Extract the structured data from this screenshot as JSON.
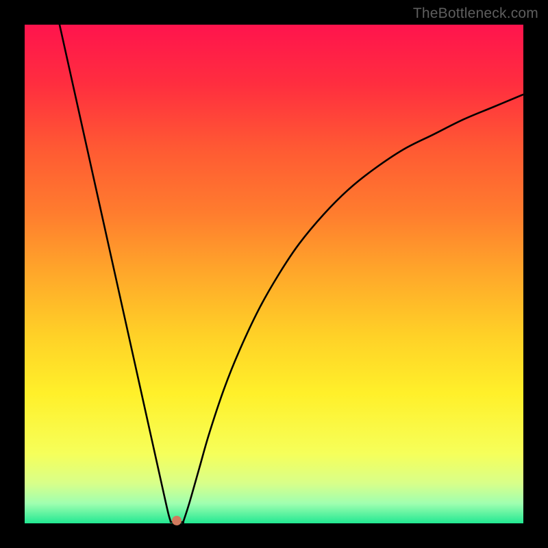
{
  "watermark": "TheBottleneck.com",
  "chart_data": {
    "type": "line",
    "title": "",
    "xlabel": "",
    "ylabel": "",
    "xlim": [
      0,
      100
    ],
    "ylim": [
      0,
      100
    ],
    "background_gradient": {
      "direction": "vertical",
      "stops": [
        {
          "pos": 0.0,
          "color": "#ff144d"
        },
        {
          "pos": 0.12,
          "color": "#ff2e3f"
        },
        {
          "pos": 0.25,
          "color": "#ff5a33"
        },
        {
          "pos": 0.38,
          "color": "#ff7d2e"
        },
        {
          "pos": 0.5,
          "color": "#ffa82a"
        },
        {
          "pos": 0.62,
          "color": "#ffd027"
        },
        {
          "pos": 0.74,
          "color": "#fff02a"
        },
        {
          "pos": 0.86,
          "color": "#f6ff5a"
        },
        {
          "pos": 0.92,
          "color": "#d8ff8a"
        },
        {
          "pos": 0.96,
          "color": "#a0ffb0"
        },
        {
          "pos": 1.0,
          "color": "#22e892"
        }
      ]
    },
    "series": [
      {
        "name": "left-branch",
        "x": [
          7.0,
          9.0,
          11.0,
          13.0,
          15.0,
          17.0,
          19.0,
          21.0,
          23.0,
          25.0,
          26.0,
          27.0,
          28.0,
          28.8,
          29.2,
          29.3
        ],
        "y": [
          100.0,
          91.0,
          82.0,
          73.0,
          64.0,
          55.0,
          46.0,
          37.0,
          28.0,
          19.0,
          14.5,
          10.0,
          5.5,
          2.0,
          0.6,
          0.3
        ]
      },
      {
        "name": "valley-floor",
        "x": [
          29.3,
          30.0,
          31.0,
          31.8
        ],
        "y": [
          0.3,
          0.2,
          0.2,
          0.3
        ]
      },
      {
        "name": "right-branch",
        "x": [
          31.8,
          33.0,
          35.0,
          37.0,
          40.0,
          43.0,
          47.0,
          51.0,
          55.0,
          60.0,
          65.0,
          70.0,
          76.0,
          82.0,
          88.0,
          94.0,
          100.0
        ],
        "y": [
          0.3,
          4.0,
          11.0,
          18.0,
          27.0,
          34.5,
          43.0,
          50.0,
          56.0,
          62.0,
          67.0,
          71.0,
          75.0,
          78.0,
          81.0,
          83.5,
          86.0
        ]
      }
    ],
    "marker": {
      "name": "minimum-point",
      "x": 30.5,
      "y": 0.5,
      "color": "#d17a5e"
    }
  }
}
